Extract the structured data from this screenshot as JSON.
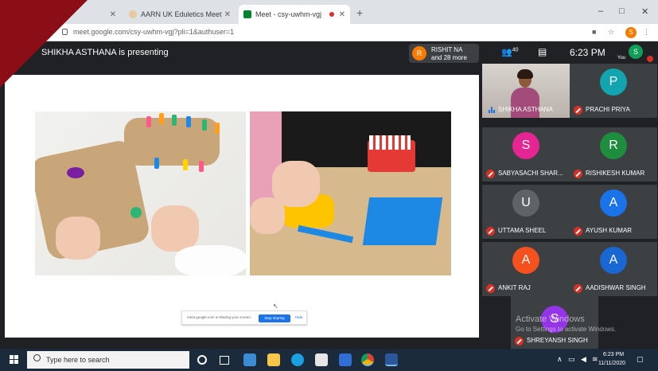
{
  "browser": {
    "tabs": [
      {
        "title": "",
        "active": false
      },
      {
        "title": "AARN UK Eduletics Meet",
        "active": false
      },
      {
        "title": "Meet - csy-uwhm-vgj",
        "active": true
      }
    ],
    "new_tab": "+",
    "minimize": "–",
    "maximize": "□",
    "close": "✕",
    "url": "meet.google.com/csy-uwhm-vgj?pli=1&authuser=1",
    "profile_initial": "S"
  },
  "meet": {
    "presenting_text": "SHIKHA ASTHANA is presenting",
    "presenter_chip": {
      "initial": "R",
      "line1": "RISHIT NA",
      "line2": "and 28 more"
    },
    "people_count": "40",
    "time": "6:23 PM",
    "self": {
      "initial": "S",
      "label": "You"
    }
  },
  "share_bar": {
    "message": "meet.google.com is sharing your screen.",
    "stop_label": "Stop sharing",
    "hide_label": "Hide"
  },
  "participants": [
    {
      "name": "SHIKHA ASTHANA",
      "initial": "",
      "color": "",
      "video": true,
      "muted": false
    },
    {
      "name": "PRACHI PRIYA",
      "initial": "P",
      "color": "#12a4af",
      "video": false,
      "muted": true
    },
    {
      "name": "SABYASACHI SHAR...",
      "initial": "S",
      "color": "#e52592",
      "video": false,
      "muted": true
    },
    {
      "name": "RISHIKESH KUMAR",
      "initial": "R",
      "color": "#1e8e3e",
      "video": false,
      "muted": true
    },
    {
      "name": "UTTAMA SHEEL",
      "initial": "U",
      "color": "#5f6368",
      "video": false,
      "muted": true
    },
    {
      "name": "AYUSH KUMAR",
      "initial": "A",
      "color": "#1a73e8",
      "video": false,
      "muted": true
    },
    {
      "name": "ANKIT RAJ",
      "initial": "A",
      "color": "#f4511e",
      "video": false,
      "muted": true
    },
    {
      "name": "AADISHWAR SINGH",
      "initial": "A",
      "color": "#1967d2",
      "video": false,
      "muted": true
    },
    {
      "name": "SHREYANSH SINGH",
      "initial": "S",
      "color": "#9334e6",
      "video": false,
      "muted": true
    }
  ],
  "watermark": {
    "line1": "Activate Windows",
    "line2": "Go to Settings to activate Windows."
  },
  "taskbar": {
    "search_placeholder": "Type here to search",
    "time": "6:23 PM",
    "date": "11/11/2020"
  }
}
